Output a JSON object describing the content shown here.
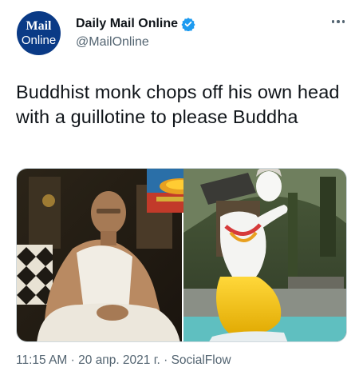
{
  "account": {
    "avatar_line1": "Mail",
    "avatar_line2": "Online",
    "display_name": "Daily Mail Online",
    "handle": "@MailOnline",
    "verified": true
  },
  "tweet": {
    "text": "Buddhist monk chops off his own head with a guillotine to please Buddha"
  },
  "meta": {
    "time": "11:15 AM",
    "separator": "·",
    "date": "20 апр. 2021 г.",
    "source": "SocialFlow"
  },
  "colors": {
    "brand_avatar": "#0a3a86",
    "verified_blue": "#1d9bf0",
    "secondary_text": "#536471",
    "primary_text": "#0f1419"
  },
  "icons": {
    "verified": "verified-badge-icon",
    "more": "more-options-icon"
  }
}
